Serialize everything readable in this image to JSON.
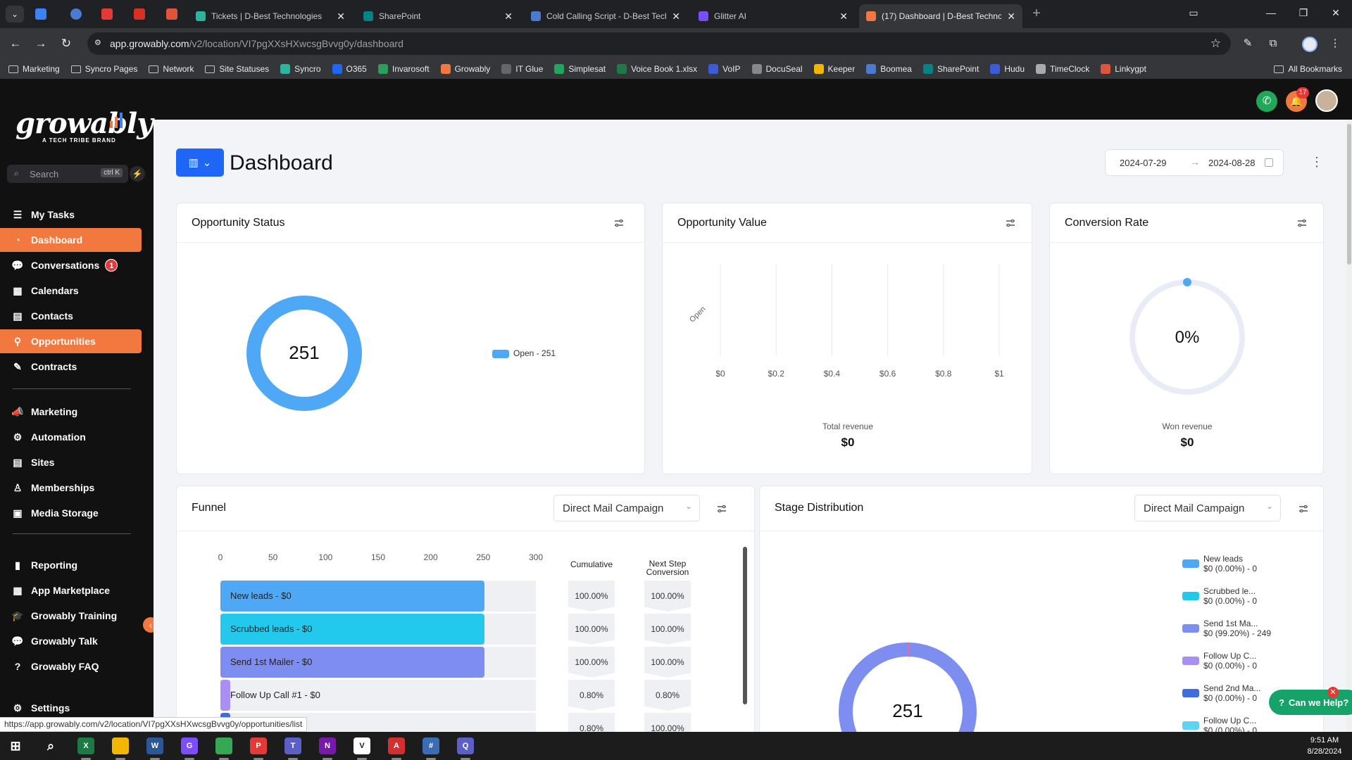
{
  "browser": {
    "tabs": [
      {
        "title": "Tickets | D-Best Technologies",
        "color": "#2bb5a0",
        "active": false
      },
      {
        "title": "SharePoint",
        "color": "#038387",
        "active": false
      },
      {
        "title": "Cold Calling Script - D-Best Tech",
        "color": "#4a7bd0",
        "active": false
      },
      {
        "title": "Glitter AI",
        "color": "#7c4dff",
        "active": false
      },
      {
        "title": "(17) Dashboard | D-Best Techno",
        "color": "#f1783f",
        "active": true
      }
    ],
    "url_host": "app.growably.com",
    "url_path": "/v2/location/VI7pgXXsHXwcsgBvvg0y/dashboard",
    "bookmarks": [
      {
        "label": "Marketing",
        "icon": "folder-icon"
      },
      {
        "label": "Syncro Pages",
        "icon": "folder-icon"
      },
      {
        "label": "Network",
        "icon": "folder-icon"
      },
      {
        "label": "Site Statuses",
        "icon": "folder-icon"
      },
      {
        "label": "Syncro",
        "icon": "syncro-icon",
        "color": "#2bb5a0"
      },
      {
        "label": "O365",
        "icon": "o365-icon",
        "color": "#1e66f5"
      },
      {
        "label": "Invarosoft",
        "icon": "invarosoft-icon",
        "color": "#2e9e5b"
      },
      {
        "label": "Growably",
        "icon": "growably-icon",
        "color": "#f1783f"
      },
      {
        "label": "IT Glue",
        "icon": "itglue-icon",
        "color": "#666666"
      },
      {
        "label": "Simplesat",
        "icon": "simplesat-icon",
        "color": "#22a65a"
      },
      {
        "label": "Voice Book 1.xlsx",
        "icon": "excel-icon",
        "color": "#1d7a45"
      },
      {
        "label": "VoIP",
        "icon": "voip-icon",
        "color": "#3b5bdb"
      },
      {
        "label": "DocuSeal",
        "icon": "docuseal-icon",
        "color": "#888888"
      },
      {
        "label": "Keeper",
        "icon": "keeper-icon",
        "color": "#f2b705"
      },
      {
        "label": "Boomea",
        "icon": "boomea-icon",
        "color": "#4a7bd0"
      },
      {
        "label": "SharePoint",
        "icon": "sharepoint-icon",
        "color": "#038387"
      },
      {
        "label": "Hudu",
        "icon": "hudu-icon",
        "color": "#3b5bdb"
      },
      {
        "label": "TimeClock",
        "icon": "clock-icon",
        "color": "#aaaaaa"
      },
      {
        "label": "Linkygpt",
        "icon": "linkygpt-icon",
        "color": "#e0533d"
      }
    ],
    "all_bookmarks": "All Bookmarks"
  },
  "app": {
    "brand": "growably",
    "brand_sub": "A TECH TRIBE BRAND",
    "notifications_count": "17",
    "search": {
      "placeholder": "Search",
      "shortcut": "ctrl K"
    },
    "nav": [
      {
        "label": "My Tasks",
        "icon": "tasks-icon",
        "active": false
      },
      {
        "label": "Dashboard",
        "icon": "dashboard-icon",
        "active": true
      },
      {
        "label": "Conversations",
        "icon": "chat-icon",
        "active": false,
        "badge": "1"
      },
      {
        "label": "Calendars",
        "icon": "calendar-icon",
        "active": false
      },
      {
        "label": "Contacts",
        "icon": "contacts-icon",
        "active": false
      },
      {
        "label": "Opportunities",
        "icon": "opportunities-icon",
        "active": true
      },
      {
        "label": "Contracts",
        "icon": "contracts-icon",
        "active": false
      }
    ],
    "nav2": [
      {
        "label": "Marketing",
        "icon": "marketing-icon"
      },
      {
        "label": "Automation",
        "icon": "automation-icon"
      },
      {
        "label": "Sites",
        "icon": "sites-icon"
      },
      {
        "label": "Memberships",
        "icon": "memberships-icon"
      },
      {
        "label": "Media Storage",
        "icon": "media-icon"
      }
    ],
    "nav3": [
      {
        "label": "Reporting",
        "icon": "reporting-icon"
      },
      {
        "label": "App Marketplace",
        "icon": "marketplace-icon"
      },
      {
        "label": "Growably Training",
        "icon": "training-icon"
      },
      {
        "label": "Growably Talk",
        "icon": "talk-icon"
      },
      {
        "label": "Growably FAQ",
        "icon": "faq-icon"
      }
    ],
    "settings": "Settings"
  },
  "dashboard": {
    "title": "Dashboard",
    "date_from": "2024-07-29",
    "date_to": "2024-08-28",
    "opportunity_status": {
      "title": "Opportunity Status",
      "total": "251",
      "legend": "Open - 251",
      "color": "#4fa8f5"
    },
    "opportunity_value": {
      "title": "Opportunity Value",
      "category": "Open",
      "ticks": [
        "$0",
        "$0.2",
        "$0.4",
        "$0.6",
        "$0.8",
        "$1"
      ],
      "total_label": "Total revenue",
      "total": "$0"
    },
    "conversion_rate": {
      "title": "Conversion Rate",
      "value": "0%",
      "label": "Won revenue",
      "won": "$0"
    },
    "funnel": {
      "title": "Funnel",
      "pipeline": "Direct Mail Campaign",
      "axis": [
        "0",
        "50",
        "100",
        "150",
        "200",
        "250",
        "300"
      ],
      "col_cumulative": "Cumulative",
      "col_next": "Next Step Conversion",
      "rows": [
        {
          "label": "New leads - $0",
          "count": 251,
          "cumulative": "100.00%",
          "next": "100.00%",
          "color": "#4fa8f5"
        },
        {
          "label": "Scrubbed leads - $0",
          "count": 251,
          "cumulative": "100.00%",
          "next": "100.00%",
          "color": "#22c9ec"
        },
        {
          "label": "Send 1st Mailer - $0",
          "count": 251,
          "cumulative": "100.00%",
          "next": "100.00%",
          "color": "#7e8ef0"
        },
        {
          "label": "Follow Up Call #1 - $0",
          "count": 2,
          "cumulative": "0.80%",
          "next": "0.80%",
          "color": "#a98ff2"
        },
        {
          "label": "",
          "count": 2,
          "cumulative": "0.80%",
          "next": "100.00%",
          "color": "#3f6de0"
        }
      ]
    },
    "stage_distribution": {
      "title": "Stage Distribution",
      "pipeline": "Direct Mail Campaign",
      "total": "251",
      "legend": [
        {
          "name": "New leads",
          "detail": "$0 (0.00%) - 0",
          "color": "#4fa8f5"
        },
        {
          "name": "Scrubbed le...",
          "detail": "$0 (0.00%) - 0",
          "color": "#22c9ec"
        },
        {
          "name": "Send 1st Ma...",
          "detail": "$0 (99.20%) - 249",
          "color": "#7e8ef0"
        },
        {
          "name": "Follow Up C...",
          "detail": "$0 (0.00%) - 0",
          "color": "#a98ff2"
        },
        {
          "name": "Send 2nd Ma...",
          "detail": "$0 (0.00%) - 0",
          "color": "#3f6de0"
        },
        {
          "name": "Follow Up C...",
          "detail": "$0 (0.00%) - 0",
          "color": "#5fd3f3"
        }
      ]
    }
  },
  "help": {
    "label": "Can we Help?"
  },
  "status_url": "https://app.growably.com/v2/location/VI7pgXXsHXwcsgBvvg0y/opportunities/list",
  "taskbar": {
    "time": "9:51 AM",
    "date": "8/28/2024",
    "apps": [
      {
        "name": "excel-icon",
        "color": "#1d7a45",
        "glyph": "X"
      },
      {
        "name": "file-explorer-icon",
        "color": "#f2b705",
        "glyph": ""
      },
      {
        "name": "word-icon",
        "color": "#2b579a",
        "glyph": "W"
      },
      {
        "name": "glitter-icon",
        "color": "#7c4dff",
        "glyph": "G"
      },
      {
        "name": "chrome-icon",
        "color": "#34a853",
        "glyph": ""
      },
      {
        "name": "pen-icon",
        "color": "#e53935",
        "glyph": "P"
      },
      {
        "name": "teams-icon",
        "color": "#5b5fc7",
        "glyph": "T"
      },
      {
        "name": "onenote-icon",
        "color": "#7719aa",
        "glyph": "N"
      },
      {
        "name": "visual-studio-icon",
        "color": "#ffffff",
        "glyph": "V"
      },
      {
        "name": "acrobat-icon",
        "color": "#d32f2f",
        "glyph": "A"
      },
      {
        "name": "calculator-icon",
        "color": "#3a6db5",
        "glyph": "#"
      },
      {
        "name": "app-icon",
        "color": "#5b5fc7",
        "glyph": "Q"
      }
    ]
  }
}
